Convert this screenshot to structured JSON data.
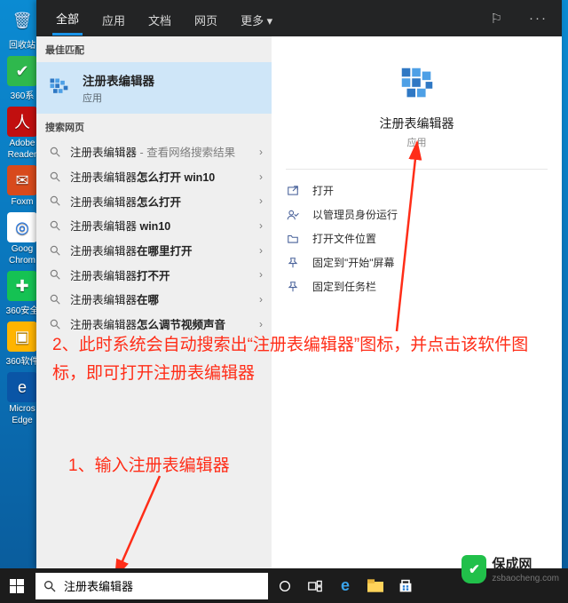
{
  "desktop_icons": [
    {
      "name": "recycle-bin",
      "label": "回收站",
      "bg": "transparent",
      "fg": "#cfe4ff",
      "glyph": "🗑"
    },
    {
      "name": "360-safe",
      "label": "360系",
      "bg": "#2fb84d",
      "fg": "#fff",
      "glyph": "✔"
    },
    {
      "name": "adobe-reader",
      "label": "Adobe\nReader",
      "bg": "#c10f0f",
      "fg": "#fff",
      "glyph": "人"
    },
    {
      "name": "foxmail",
      "label": "Foxm",
      "bg": "#d84a1c",
      "fg": "#fff",
      "glyph": "✉"
    },
    {
      "name": "chrome",
      "label": "Goog\nChrom",
      "bg": "#ffffff",
      "fg": "#1a73e8",
      "glyph": "◎"
    },
    {
      "name": "360-secure-2",
      "label": "360安全",
      "bg": "#15c253",
      "fg": "#fff",
      "glyph": "✚"
    },
    {
      "name": "360-software",
      "label": "360软件",
      "bg": "#ffb400",
      "fg": "#fff",
      "glyph": "▣"
    },
    {
      "name": "edge",
      "label": "Micros\nEdge",
      "bg": "#0a55a6",
      "fg": "#fff",
      "glyph": "e"
    }
  ],
  "header": {
    "tabs": [
      "全部",
      "应用",
      "文档",
      "网页",
      "更多 ▾"
    ],
    "active": 0
  },
  "best_match_header": "最佳匹配",
  "best_match": {
    "title": "注册表编辑器",
    "subtitle": "应用"
  },
  "web_header": "搜索网页",
  "web_items": [
    {
      "plain": "注册表编辑器",
      "bold": "",
      "extra": " - 查看网络搜索结果"
    },
    {
      "plain": "注册表编辑器",
      "bold": "怎么打开 win10",
      "extra": ""
    },
    {
      "plain": "注册表编辑器",
      "bold": "怎么打开",
      "extra": ""
    },
    {
      "plain": "注册表编辑器",
      "bold": " win10",
      "extra": ""
    },
    {
      "plain": "注册表编辑器",
      "bold": "在哪里打开",
      "extra": ""
    },
    {
      "plain": "注册表编辑器",
      "bold": "打不开",
      "extra": ""
    },
    {
      "plain": "注册表编辑器",
      "bold": "在哪",
      "extra": ""
    },
    {
      "plain": "注册表编辑器",
      "bold": "怎么调节视频声音",
      "extra": ""
    }
  ],
  "detail": {
    "title": "注册表编辑器",
    "subtitle": "应用"
  },
  "actions": [
    {
      "icon": "open",
      "label": "打开"
    },
    {
      "icon": "admin",
      "label": "以管理员身份运行"
    },
    {
      "icon": "folder",
      "label": "打开文件位置"
    },
    {
      "icon": "pin-start",
      "label": "固定到\"开始\"屏幕"
    },
    {
      "icon": "pin-task",
      "label": "固定到任务栏"
    }
  ],
  "annotations": {
    "step2": "2、此时系统会自动搜索出“注册表编辑器”图标，并点击该软件图标，即可打开注册表编辑器",
    "step1": "1、输入注册表编辑器"
  },
  "taskbar": {
    "search_value": "注册表编辑器"
  },
  "watermark": {
    "big": "保成网",
    "small": "zsbaocheng.com"
  }
}
